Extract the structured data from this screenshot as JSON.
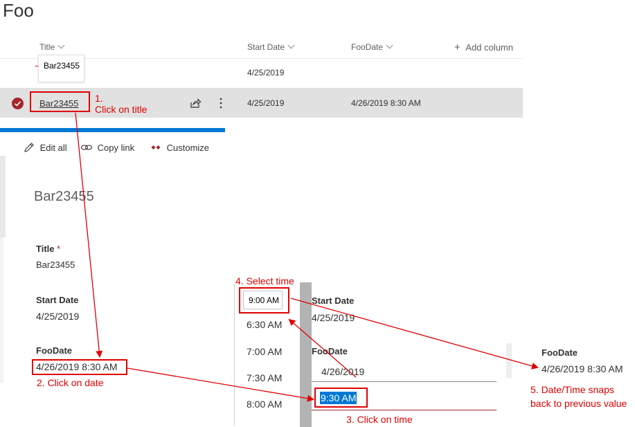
{
  "list": {
    "title": "Foo",
    "columns": {
      "title": "Title",
      "start_date": "Start Date",
      "foo_date": "FooDate",
      "add_column": "Add column"
    },
    "row1": {
      "start_date": "4/25/2019",
      "tooltip": "Bar23455"
    },
    "row2": {
      "title": "Bar23455",
      "start_date": "4/25/2019",
      "foo_date": "4/26/2019 8:30 AM"
    }
  },
  "panel": {
    "toolbar": {
      "edit_all": "Edit all",
      "copy_link": "Copy link",
      "customize": "Customize"
    },
    "item_title": "Bar23455",
    "fields": {
      "title_label": "Title",
      "required_mark": "*",
      "title_value": "Bar23455",
      "start_date_label": "Start Date",
      "start_date_value": "4/25/2019",
      "foo_date_label": "FooDate",
      "foo_date_value": "4/26/2019 8:30 AM"
    }
  },
  "editor": {
    "time_options": [
      "9:00 AM",
      "6:30 AM",
      "7:00 AM",
      "7:30 AM",
      "8:00 AM"
    ],
    "start_date_label": "Start Date",
    "start_date_value": "4/25/2019",
    "foo_date_label": "FooDate",
    "date_value": "4/26/2019",
    "time_value": "9:30 AM"
  },
  "result": {
    "foo_date_label": "FooDate",
    "foo_date_value": "4/26/2019 8:30 AM"
  },
  "annotations": {
    "step1_num": "1.",
    "step1_text": "Click on title",
    "step2": "2. Click on date",
    "step3": "3. Click on time",
    "step4": "4. Select time",
    "step5_line1": "5. Date/Time snaps",
    "step5_line2": "back to previous value"
  },
  "colors": {
    "annotation": "#e00000",
    "selected_row": "#e1e1e1",
    "accent": "#0078d4",
    "check": "#a4262c",
    "time_highlight": "#0078d4"
  }
}
